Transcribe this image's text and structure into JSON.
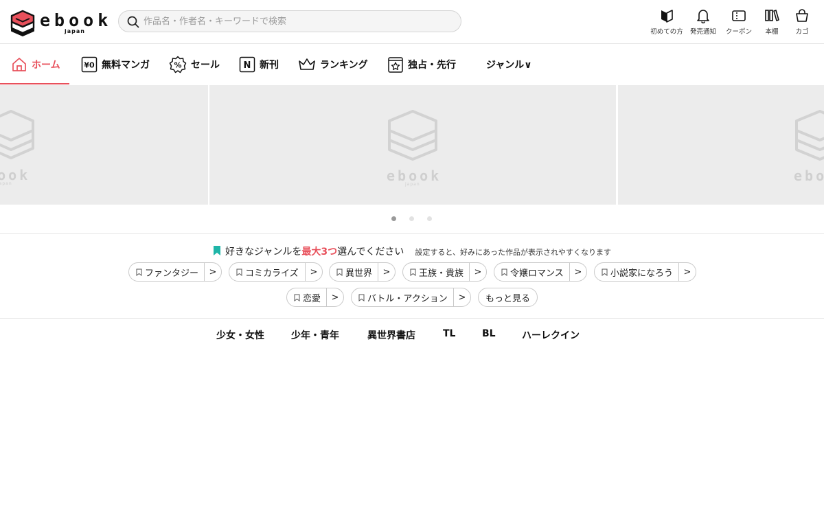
{
  "header": {
    "logo_text": "ebook",
    "logo_sub": "japan",
    "search_placeholder": "作品名・作者名・キーワードで検索",
    "icons": [
      {
        "name": "beginner-icon",
        "label": "初めての方"
      },
      {
        "name": "bell-icon",
        "label": "発売通知"
      },
      {
        "name": "coupon-icon",
        "label": "クーポン"
      },
      {
        "name": "bookshelf-icon",
        "label": "本棚"
      },
      {
        "name": "cart-icon",
        "label": "カゴ"
      }
    ]
  },
  "nav": {
    "items": [
      {
        "label": "ホーム",
        "active": true
      },
      {
        "label": "無料マンガ"
      },
      {
        "label": "セール"
      },
      {
        "label": "新刊"
      },
      {
        "label": "ランキング"
      },
      {
        "label": "独占・先行"
      },
      {
        "label": "ジャンル∨"
      }
    ],
    "free_badge": "¥0",
    "sale_badge": "%",
    "new_badge": "N"
  },
  "carousel": {
    "placeholder_text": "ebook",
    "placeholder_sub": "japan",
    "active_index": 0
  },
  "genre_picker": {
    "title_pre": "好きなジャンルを",
    "title_em": "最大3つ",
    "title_post": "選んでください",
    "note": "設定すると、好みにあった作品が表示されやすくなります",
    "chips": [
      "ファンタジー",
      "コミカライズ",
      "異世界",
      "王族・貴族",
      "令嬢ロマンス",
      "小説家になろう",
      "恋愛",
      "バトル・アクション"
    ],
    "more_label": "もっと見る",
    "arrow": ">"
  },
  "subnav": {
    "items": [
      "少女・女性",
      "少年・青年",
      "異世界書店",
      "TL",
      "BL",
      "ハーレクイン"
    ]
  },
  "colors": {
    "accent": "#e8505b",
    "bookmark": "#1fb5a8"
  }
}
